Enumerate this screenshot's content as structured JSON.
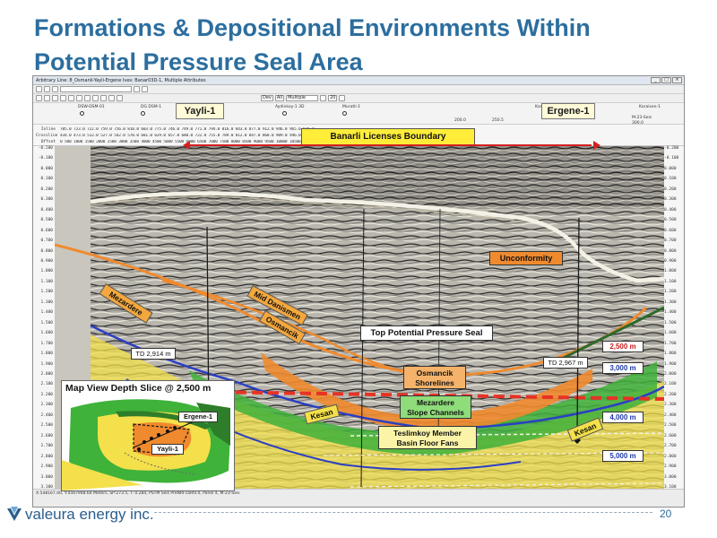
{
  "slide": {
    "title_line1": "Formations & Depositional Environments Within",
    "title_line2": "Potential Pressure Seal Area",
    "page_number": "20"
  },
  "logo": {
    "text": "valeura energy inc."
  },
  "window": {
    "title": "Arbitrary Line: 8_Osmanli-Yayli-Ergene Ives: Banar03D-1, Multiple Attributes",
    "controls": [
      "_",
      "□",
      "×"
    ],
    "toolbar2_fields": [
      "Dev",
      "All",
      "Multiple",
      "20"
    ],
    "status_line1": "X:548167.00, Y:4567948.64 Meters,  SP:273.5,  T: 0.284,  PSTM Seis PreNRFcaRhl.0,  Panel 4,  M-23-Seis",
    "wells_small": [
      "DSW-DSM-01",
      "DG DSM-1",
      "Aydinkoy-1 3D",
      "Muratli-1",
      "Karatas-1",
      "Karaisen-1",
      "M-23-Seis",
      "200.0",
      "250.5",
      "300.0"
    ]
  },
  "header_axis": {
    "rows": [
      "Inline",
      "Crossline",
      "Offset"
    ],
    "inline_ticks": "705.0 723.0 722.0 759.0 756.0 818.0 603.0 775.0 746.0 749.0 771.0 794.0 816.0 843.0 877.0 912.0 946.0 965.0 976.0",
    "crossline_ticks": "434.0 473.0 512.0 527.0 542.0 570.0 601.0 629.0 657.0 680.0 722.0 755.0 789.0 812.0 847.0 868.0 909.0 946.0",
    "offset_ticks": "0 500 1000 1500 2000 2500 3000 3500 4000 4500 5000 5500 6000 6500 7000 7500 8000 8500 9000 9500 10000 10500 11000"
  },
  "depth_axis": [
    "-0.200",
    "-0.100",
    "0.000",
    "0.100",
    "0.200",
    "0.300",
    "0.400",
    "0.500",
    "0.600",
    "0.700",
    "0.800",
    "0.900",
    "1.000",
    "1.100",
    "1.200",
    "1.300",
    "1.400",
    "1.500",
    "1.600",
    "1.700",
    "1.800",
    "1.900",
    "2.000",
    "2.100",
    "2.200",
    "2.300",
    "2.400",
    "2.500",
    "2.600",
    "2.700",
    "2.800",
    "2.900",
    "3.000",
    "3.100"
  ],
  "wells": {
    "well1": "Yayli-1",
    "well2": "Ergene-1"
  },
  "boundary": {
    "label": "Banarli Licenses Boundary"
  },
  "horizons": {
    "unconformity": "Unconformity",
    "mid_danismen": "Mid Danismen",
    "mezardere": "Mezardere",
    "osmancik": "Osmancik",
    "top_seal": "Top Potential Pressure Seal",
    "kesan_left": "Kesan",
    "kesan_right": "Kesan"
  },
  "td": {
    "left": "TD 2,914 m",
    "right": "TD 2,967 m"
  },
  "depths": {
    "d2500": "2,500 m",
    "d3000": "3,000 m",
    "d4000": "4,000 m",
    "d5000": "5,000 m"
  },
  "facies": {
    "osmancik_line1": "Osmancik",
    "osmancik_line2": "Shorelines",
    "mezardere_line1": "Mezardere",
    "mezardere_line2": "Slope Channels",
    "teslimkoy_line1": "Teslimkoy Member",
    "teslimkoy_line2": "Basin Floor Fans"
  },
  "inset": {
    "title": "Map View Depth Slice @ 2,500 m",
    "well1": "Ergene-1",
    "well2": "Yayli-1"
  },
  "colors": {
    "title": "#2c6e9e",
    "boundary": "#d42020",
    "seal": "#e63325",
    "facies_orange": "#f08a2e",
    "facies_green": "#3fb23a",
    "facies_yellow": "#f3e04a",
    "horizon_blue": "#2b3fc4",
    "horizon_white": "#f4f1e6"
  }
}
